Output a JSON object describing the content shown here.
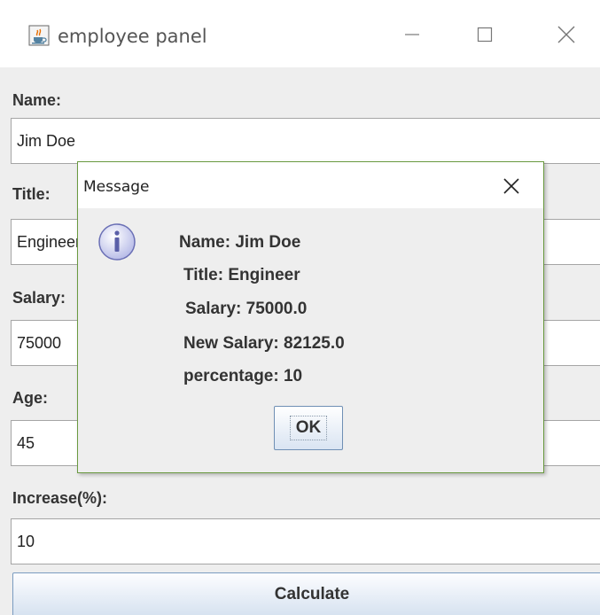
{
  "window": {
    "title": "employee panel",
    "icon": "java-cup-icon",
    "controls": [
      "minimize-icon",
      "maximize-icon",
      "close-icon"
    ]
  },
  "form": {
    "name_label": "Name:",
    "name_value": "Jim Doe",
    "title_label": "Title:",
    "title_value": "Engineer",
    "salary_label": "Salary:",
    "salary_value": "75000",
    "age_label": "Age:",
    "age_value": "45",
    "increase_label": "Increase(%):",
    "increase_value": "10",
    "calculate_label": "Calculate"
  },
  "dialog": {
    "title": "Message",
    "icon": "info-icon",
    "lines": [
      "Name: Jim Doe",
      "Title: Engineer",
      "Salary: 75000.0",
      "New Salary: 82125.0",
      "percentage: 10"
    ],
    "ok_label": "OK"
  }
}
